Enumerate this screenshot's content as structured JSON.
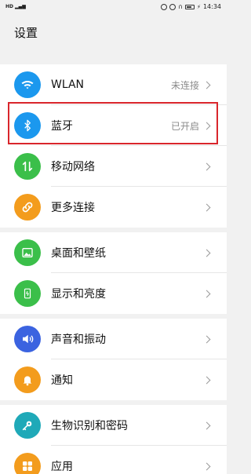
{
  "status_bar": {
    "left": "HD",
    "time": "14:34"
  },
  "page": {
    "title": "设置"
  },
  "colors": {
    "wlan": "#1b98ee",
    "bluetooth": "#1b98ee",
    "mobile": "#3bbf4a",
    "more": "#f39c1d",
    "desktop": "#3bbf4a",
    "display": "#3bbf4a",
    "sound": "#3b63e0",
    "notify": "#f39c1d",
    "biometric": "#1fa9b8",
    "apps": "#f39c1d",
    "highlight": "#d9262c"
  },
  "groups": [
    {
      "items": [
        {
          "label": "WLAN",
          "value": "未连接",
          "icon": "wifi-icon"
        },
        {
          "label": "蓝牙",
          "value": "已开启",
          "icon": "bluetooth-icon"
        },
        {
          "label": "移动网络",
          "value": "",
          "icon": "mobile-data-icon"
        },
        {
          "label": "更多连接",
          "value": "",
          "icon": "link-icon"
        }
      ]
    },
    {
      "items": [
        {
          "label": "桌面和壁纸",
          "value": "",
          "icon": "image-icon"
        },
        {
          "label": "显示和亮度",
          "value": "",
          "icon": "display-icon"
        }
      ]
    },
    {
      "items": [
        {
          "label": "声音和振动",
          "value": "",
          "icon": "speaker-icon"
        },
        {
          "label": "通知",
          "value": "",
          "icon": "bell-icon"
        }
      ]
    },
    {
      "items": [
        {
          "label": "生物识别和密码",
          "value": "",
          "icon": "key-icon"
        },
        {
          "label": "应用",
          "value": "",
          "icon": "apps-grid-icon"
        }
      ]
    }
  ]
}
